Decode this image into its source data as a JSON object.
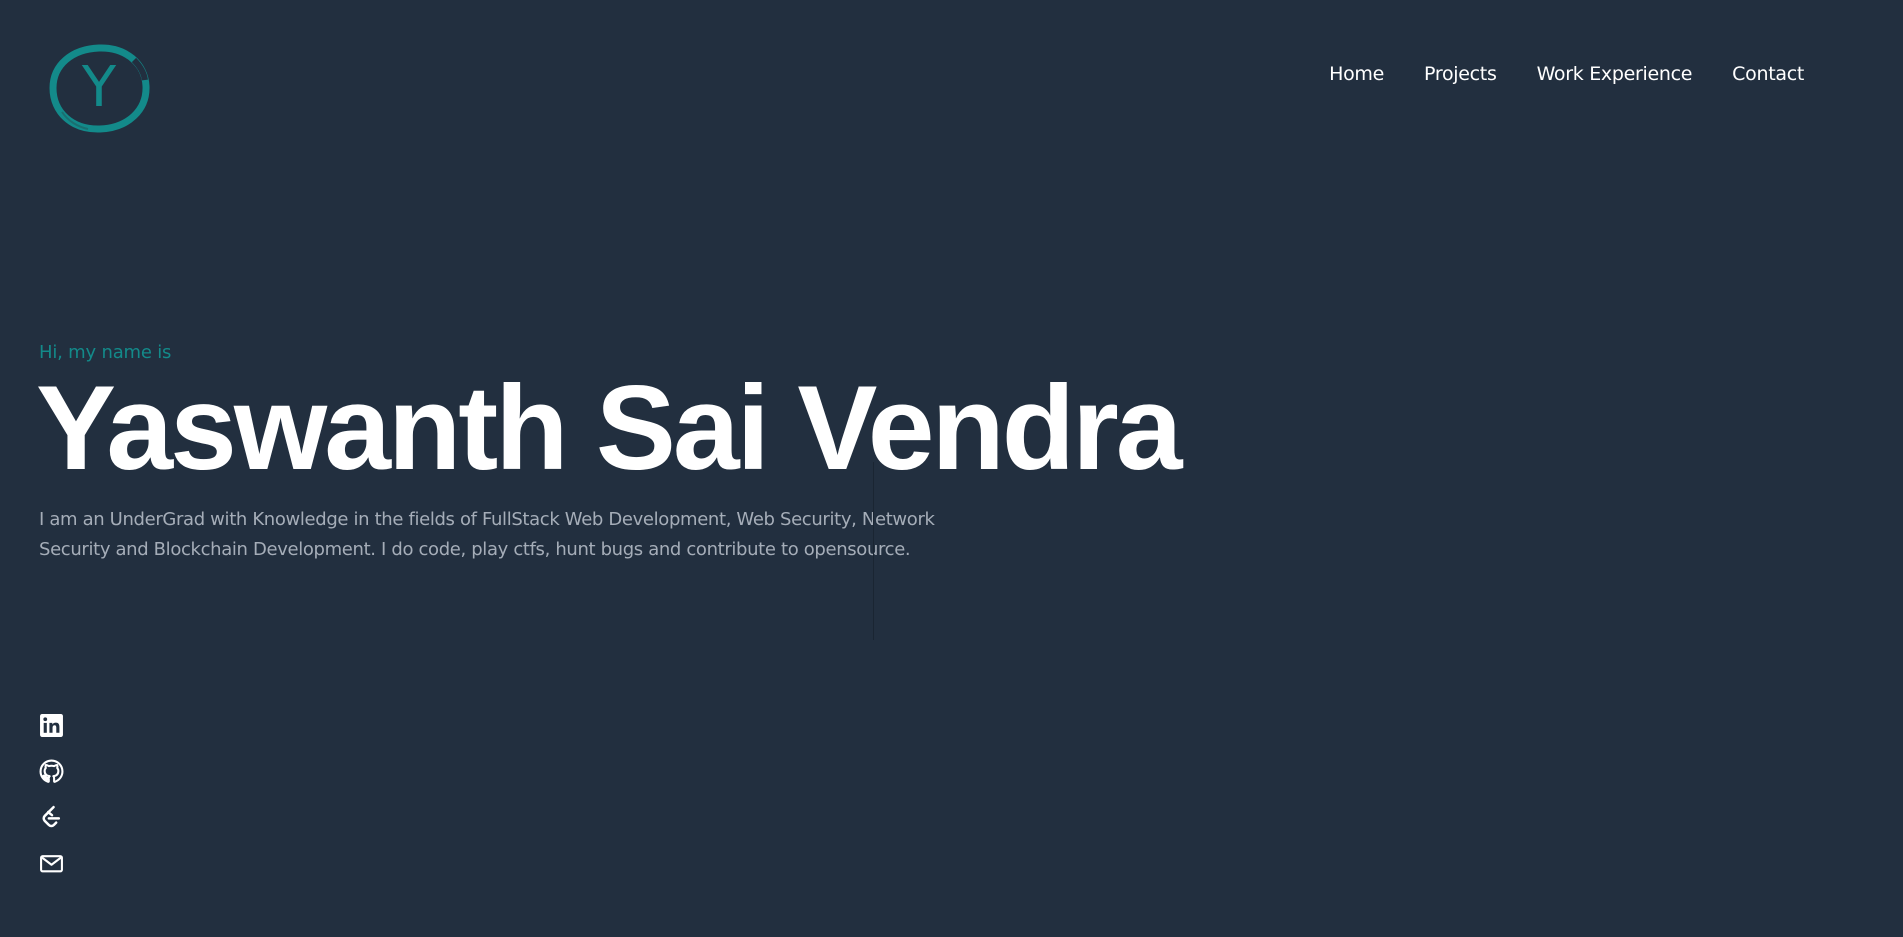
{
  "logo": {
    "letter": "Y",
    "color": "#138a8a",
    "icon": "logo-circle-icon"
  },
  "nav": {
    "items": [
      {
        "label": "Home"
      },
      {
        "label": "Projects"
      },
      {
        "label": "Work Experience"
      },
      {
        "label": "Contact"
      }
    ]
  },
  "hero": {
    "greeting": "Hi, my name is",
    "name": "Yaswanth Sai Vendra",
    "bio_lines": [
      "I am an UnderGrad with Knowledge in the fields of FullStack Web Development, Web Security, Network",
      "Security and Blockchain Development. I do code, play ctfs, hunt bugs and contribute to opensource."
    ]
  },
  "socials": [
    {
      "icon": "linkedin-icon"
    },
    {
      "icon": "github-icon"
    },
    {
      "icon": "leetcode-icon"
    },
    {
      "icon": "mail-icon"
    }
  ],
  "colors": {
    "background": "#222f3f",
    "accent": "#138a8a",
    "text": "#ffffff",
    "muted": "#a5adb8"
  }
}
